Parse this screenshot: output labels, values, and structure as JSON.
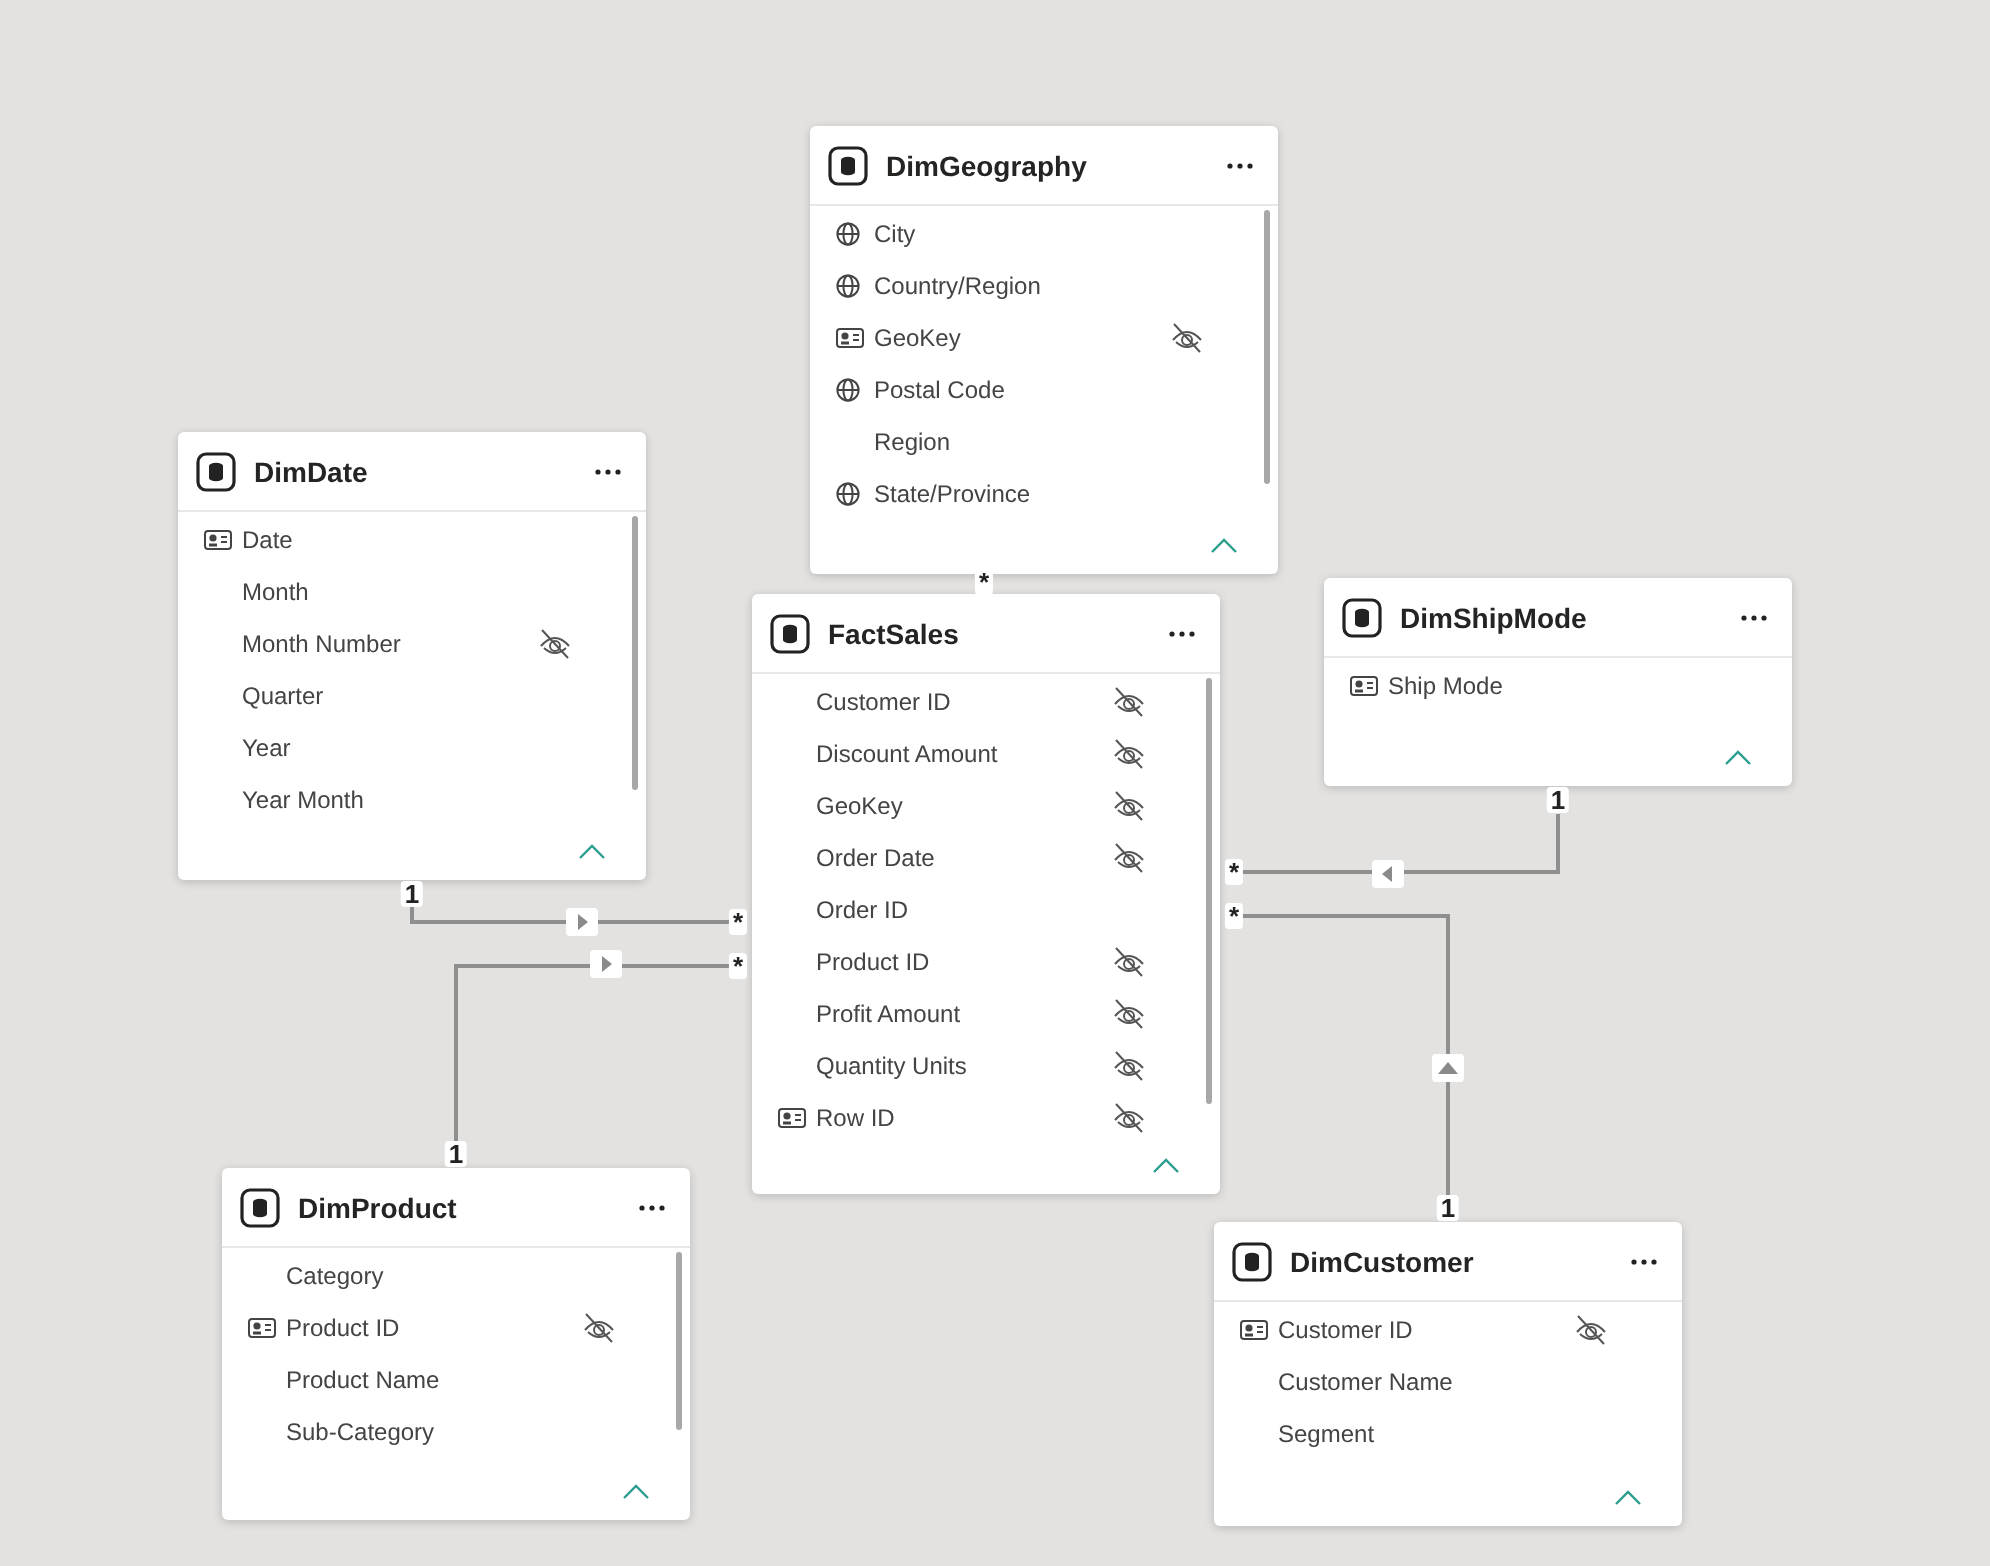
{
  "tables": [
    {
      "name": "DimGeography",
      "scrollable": true,
      "fields": [
        {
          "name": "City",
          "kind": "globe",
          "hidden": false
        },
        {
          "name": "Country/Region",
          "kind": "globe",
          "hidden": false
        },
        {
          "name": "GeoKey",
          "kind": "key",
          "hidden": true
        },
        {
          "name": "Postal Code",
          "kind": "globe",
          "hidden": false
        },
        {
          "name": "Region",
          "kind": "plain",
          "hidden": false
        },
        {
          "name": "State/Province",
          "kind": "globe",
          "hidden": false
        }
      ]
    },
    {
      "name": "DimDate",
      "scrollable": true,
      "fields": [
        {
          "name": "Date",
          "kind": "key",
          "hidden": false
        },
        {
          "name": "Month",
          "kind": "plain",
          "hidden": false
        },
        {
          "name": "Month Number",
          "kind": "plain",
          "hidden": true
        },
        {
          "name": "Quarter",
          "kind": "plain",
          "hidden": false
        },
        {
          "name": "Year",
          "kind": "plain",
          "hidden": false
        },
        {
          "name": "Year Month",
          "kind": "plain",
          "hidden": false
        }
      ]
    },
    {
      "name": "FactSales",
      "scrollable": true,
      "fields": [
        {
          "name": "Customer ID",
          "kind": "plain",
          "hidden": true
        },
        {
          "name": "Discount Amount",
          "kind": "plain",
          "hidden": true
        },
        {
          "name": "GeoKey",
          "kind": "plain",
          "hidden": true
        },
        {
          "name": "Order Date",
          "kind": "plain",
          "hidden": true
        },
        {
          "name": "Order ID",
          "kind": "plain",
          "hidden": false
        },
        {
          "name": "Product ID",
          "kind": "plain",
          "hidden": true
        },
        {
          "name": "Profit Amount",
          "kind": "plain",
          "hidden": true
        },
        {
          "name": "Quantity Units",
          "kind": "plain",
          "hidden": true
        },
        {
          "name": "Row ID",
          "kind": "key",
          "hidden": true
        }
      ]
    },
    {
      "name": "DimShipMode",
      "scrollable": false,
      "fields": [
        {
          "name": "Ship Mode",
          "kind": "key",
          "hidden": false
        }
      ]
    },
    {
      "name": "DimProduct",
      "scrollable": true,
      "fields": [
        {
          "name": "Category",
          "kind": "plain",
          "hidden": false
        },
        {
          "name": "Product ID",
          "kind": "key",
          "hidden": true
        },
        {
          "name": "Product Name",
          "kind": "plain",
          "hidden": false
        },
        {
          "name": "Sub-Category",
          "kind": "plain",
          "hidden": false
        }
      ]
    },
    {
      "name": "DimCustomer",
      "scrollable": false,
      "fields": [
        {
          "name": "Customer ID",
          "kind": "key",
          "hidden": true
        },
        {
          "name": "Customer Name",
          "kind": "plain",
          "hidden": false
        },
        {
          "name": "Segment",
          "kind": "plain",
          "hidden": false
        }
      ]
    }
  ],
  "relationships": [
    {
      "one": "1",
      "many": "*",
      "kind": "right"
    },
    {
      "one": "1",
      "many": "*",
      "kind": "right"
    },
    {
      "one": "1",
      "many": "*",
      "kind": "left"
    },
    {
      "one": "1",
      "many": "*",
      "kind": "up"
    },
    {
      "many": "*"
    }
  ]
}
